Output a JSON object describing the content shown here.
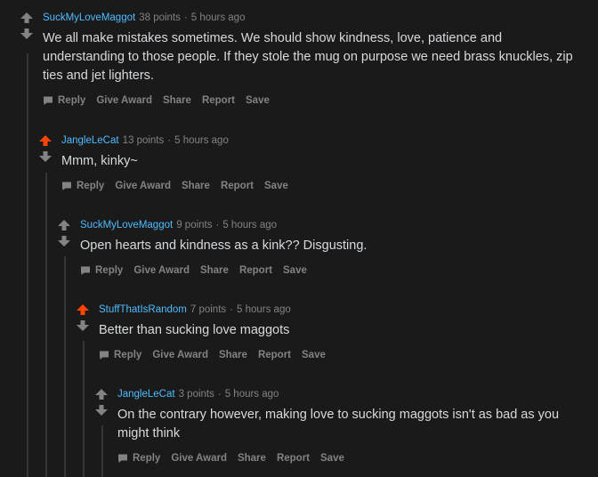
{
  "colors": {
    "background": "#1a1a1b",
    "author": "#4fbcff",
    "upvoted": "#ff4500",
    "muted": "#818384",
    "text": "#d7dadc"
  },
  "actions": {
    "reply": "Reply",
    "give_award": "Give Award",
    "share": "Share",
    "report": "Report",
    "save": "Save"
  },
  "comments": [
    {
      "author": "SuckMyLoveMaggot",
      "points": "38 points",
      "time": "5 hours ago",
      "upvoted": false,
      "text": "We all make mistakes sometimes. We should show kindness, love, patience and understanding to those people. If they stole the mug on purpose we need brass knuckles, zip ties and jet lighters."
    },
    {
      "author": "JangleLeCat",
      "points": "13 points",
      "time": "5 hours ago",
      "upvoted": true,
      "text": "Mmm, kinky~"
    },
    {
      "author": "SuckMyLoveMaggot",
      "points": "9 points",
      "time": "5 hours ago",
      "upvoted": false,
      "text": "Open hearts and kindness as a kink?? Disgusting."
    },
    {
      "author": "StuffThatIsRandom",
      "points": "7 points",
      "time": "5 hours ago",
      "upvoted": true,
      "text": "Better than sucking love maggots"
    },
    {
      "author": "JangleLeCat",
      "points": "3 points",
      "time": "5 hours ago",
      "upvoted": false,
      "text": "On the contrary however, making love to sucking maggots isn't as bad as you might think"
    }
  ]
}
